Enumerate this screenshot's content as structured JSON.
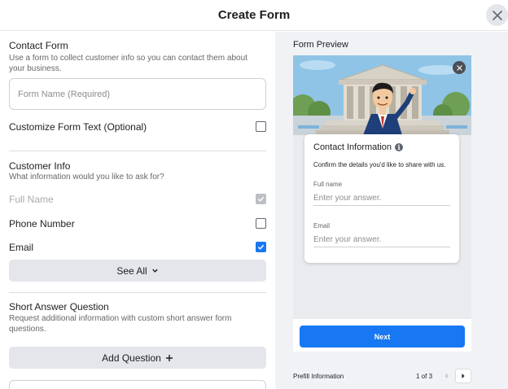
{
  "header": {
    "title": "Create Form"
  },
  "contact_form": {
    "title": "Contact Form",
    "description": "Use a form to collect customer info so you can contact them about your business.",
    "form_name_placeholder": "Form Name (Required)",
    "customize_label": "Customize Form Text (Optional)",
    "customize_checked": false
  },
  "customer_info": {
    "title": "Customer Info",
    "description": "What information would you like to ask for?",
    "fields": [
      {
        "label": "Full Name",
        "checked": true,
        "disabled": true
      },
      {
        "label": "Phone Number",
        "checked": false,
        "disabled": false
      },
      {
        "label": "Email",
        "checked": true,
        "disabled": false
      }
    ],
    "see_all_label": "See All"
  },
  "short_answer": {
    "title": "Short Answer Question",
    "description": "Request additional information with custom short answer form questions.",
    "add_label": "Add Question"
  },
  "preview": {
    "title": "Form Preview",
    "card_title": "Contact Information",
    "card_desc": "Confirm the details you'd like to share with us.",
    "fields": [
      {
        "label": "Full name",
        "placeholder": "Enter your answer."
      },
      {
        "label": "Email",
        "placeholder": "Enter your answer."
      }
    ],
    "next_label": "Next",
    "footer_label": "Prefill Information",
    "page_count": "1 of 3"
  },
  "colors": {
    "accent": "#1877f2",
    "divider": "#dadde1",
    "button_gray": "#e4e6eb"
  }
}
